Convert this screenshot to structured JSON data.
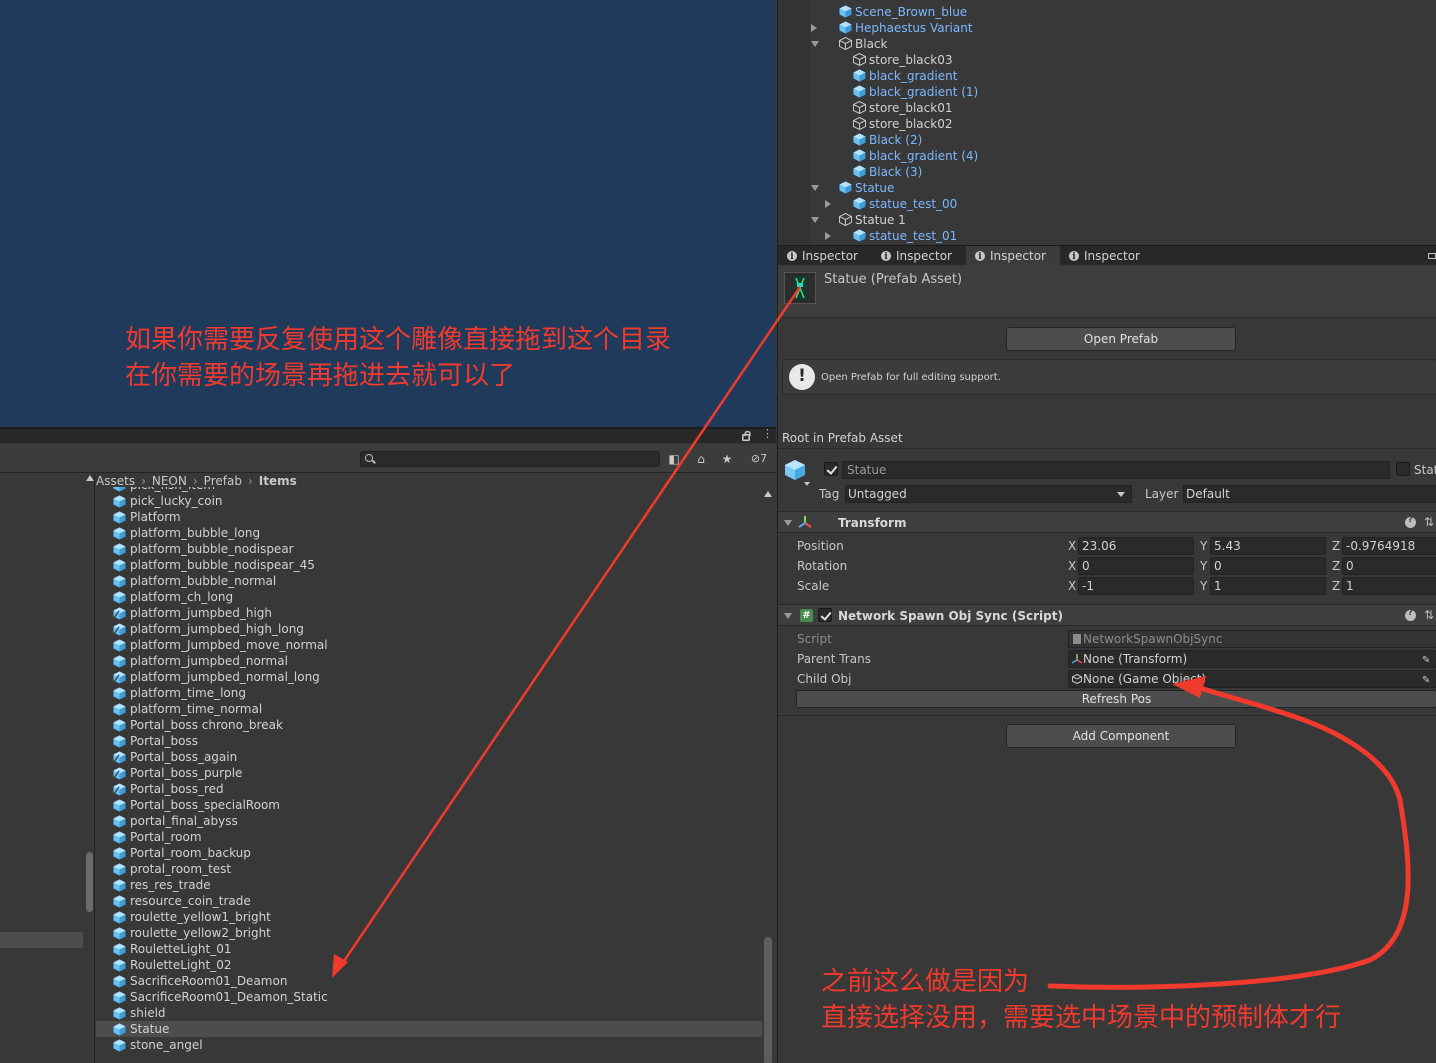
{
  "hierarchy": {
    "rows": [
      {
        "label": "Scene_Brown_blue",
        "prefab": true,
        "arrow": "none",
        "depth": 0
      },
      {
        "label": "Hephaestus Variant",
        "prefab": true,
        "arrow": "right",
        "depth": 0
      },
      {
        "label": "Black",
        "prefab": false,
        "arrow": "down",
        "depth": 0
      },
      {
        "label": "store_black03",
        "prefab": false,
        "arrow": "none",
        "depth": 1
      },
      {
        "label": "black_gradient",
        "prefab": true,
        "arrow": "none",
        "depth": 1
      },
      {
        "label": "black_gradient (1)",
        "prefab": true,
        "arrow": "none",
        "depth": 1
      },
      {
        "label": "store_black01",
        "prefab": false,
        "arrow": "none",
        "depth": 1
      },
      {
        "label": "store_black02",
        "prefab": false,
        "arrow": "none",
        "depth": 1
      },
      {
        "label": "Black (2)",
        "prefab": true,
        "arrow": "none",
        "depth": 1
      },
      {
        "label": "black_gradient (4)",
        "prefab": true,
        "arrow": "none",
        "depth": 1
      },
      {
        "label": "Black (3)",
        "prefab": true,
        "arrow": "none",
        "depth": 1
      },
      {
        "label": "Statue",
        "prefab": true,
        "arrow": "down",
        "depth": 0
      },
      {
        "label": "statue_test_00",
        "prefab": true,
        "arrow": "right",
        "depth": 1
      },
      {
        "label": "Statue 1",
        "prefab": false,
        "arrow": "down",
        "depth": 0
      },
      {
        "label": "statue_test_01",
        "prefab": true,
        "arrow": "right",
        "depth": 1
      }
    ]
  },
  "inspector": {
    "tabs": [
      "Inspector",
      "Inspector",
      "Inspector",
      "Inspector"
    ],
    "active_tab": 2,
    "asset_title": "Statue (Prefab Asset)",
    "open_prefab_label": "Open Prefab",
    "help_text": "Open Prefab for full editing support.",
    "root_label": "Root in Prefab Asset",
    "object_name": "Statue",
    "static_label": "Stat",
    "tag_label": "Tag",
    "tag_value": "Untagged",
    "layer_label": "Layer",
    "layer_value": "Default",
    "transform": {
      "title": "Transform",
      "position_label": "Position",
      "rotation_label": "Rotation",
      "scale_label": "Scale",
      "axis_x": "X",
      "axis_y": "Y",
      "axis_z": "Z",
      "position": {
        "x": "23.06",
        "y": "5.43",
        "z": "-0.9764918"
      },
      "rotation": {
        "x": "0",
        "y": "0",
        "z": "0"
      },
      "scale": {
        "x": "-1",
        "y": "1",
        "z": "1"
      }
    },
    "script_component": {
      "title": "Network Spawn Obj Sync (Script)",
      "script_label": "Script",
      "script_value": "NetworkSpawnObjSync",
      "parent_trans_label": "Parent Trans",
      "parent_trans_value": "None (Transform)",
      "child_obj_label": "Child Obj",
      "child_obj_value": "None (Game Object)",
      "refresh_label": "Refresh Pos"
    },
    "add_component_label": "Add Component"
  },
  "project": {
    "breadcrumb": [
      "Assets",
      "NEON",
      "Prefab",
      "Items"
    ],
    "filter_count": "7",
    "assets": [
      {
        "label": "pick_fish_item",
        "variant": false
      },
      {
        "label": "pick_lucky_coin",
        "variant": false
      },
      {
        "label": "Platform",
        "variant": false
      },
      {
        "label": "platform_bubble_long",
        "variant": false
      },
      {
        "label": "platform_bubble_nodispear",
        "variant": false
      },
      {
        "label": "platform_bubble_nodispear_45",
        "variant": false
      },
      {
        "label": "platform_bubble_normal",
        "variant": false
      },
      {
        "label": "platform_ch_long",
        "variant": false
      },
      {
        "label": "platform_jumpbed_high",
        "variant": true
      },
      {
        "label": "platform_jumpbed_high_long",
        "variant": true
      },
      {
        "label": "platform_Jumpbed_move_normal",
        "variant": false
      },
      {
        "label": "platform_jumpbed_normal",
        "variant": false
      },
      {
        "label": "platform_jumpbed_normal_long",
        "variant": true
      },
      {
        "label": "platform_time_long",
        "variant": false
      },
      {
        "label": "platform_time_normal",
        "variant": false
      },
      {
        "label": "Portal_boss chrono_break",
        "variant": false
      },
      {
        "label": "Portal_boss",
        "variant": false
      },
      {
        "label": "Portal_boss_again",
        "variant": true
      },
      {
        "label": "Portal_boss_purple",
        "variant": true
      },
      {
        "label": "Portal_boss_red",
        "variant": true
      },
      {
        "label": "Portal_boss_specialRoom",
        "variant": false
      },
      {
        "label": "portal_final_abyss",
        "variant": false
      },
      {
        "label": "Portal_room",
        "variant": false
      },
      {
        "label": "Portal_room_backup",
        "variant": false
      },
      {
        "label": "protal_room_test",
        "variant": false
      },
      {
        "label": "res_res_trade",
        "variant": false
      },
      {
        "label": "resource_coin_trade",
        "variant": false
      },
      {
        "label": "roulette_yellow1_bright",
        "variant": false
      },
      {
        "label": "roulette_yellow2_bright",
        "variant": false
      },
      {
        "label": "RouletteLight_01",
        "variant": false
      },
      {
        "label": "RouletteLight_02",
        "variant": false
      },
      {
        "label": "SacrificeRoom01_Deamon",
        "variant": false
      },
      {
        "label": "SacrificeRoom01_Deamon_Static",
        "variant": false
      },
      {
        "label": "shield",
        "variant": false
      },
      {
        "label": "Statue",
        "variant": false,
        "selected": true
      },
      {
        "label": "stone_angel",
        "variant": false
      }
    ]
  },
  "annotations": {
    "top_line1": "如果你需要反复使用这个雕像直接拖到这个目录",
    "top_line2": "在你需要的场景再拖进去就可以了",
    "bottom_line1": "之前这么做是因为",
    "bottom_line2": "直接选择没用，需要选中场景中的预制体才行",
    "color": "#f03a2e"
  },
  "colors": {
    "prefab_blue": "#7cb8ff",
    "scene_bg": "#1f3a5a",
    "panel_bg": "#383838"
  }
}
